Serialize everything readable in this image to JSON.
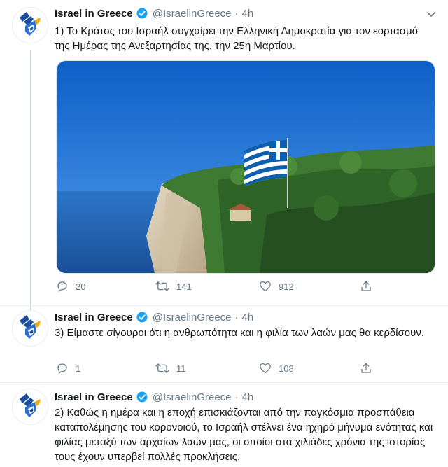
{
  "account": {
    "name": "Israel in Greece",
    "handle": "@IsraelinGreece"
  },
  "tweets": [
    {
      "time": "4h",
      "text": "1) Το Κράτος του Ισραήλ συγχαίρει την Ελληνική Δημοκρατία για τον εορτασμό της Ημέρας της Ανεξαρτησίας της, την 25η Μαρτίου.",
      "media": "photo of Greek flag on a cliff above the sea",
      "replies": "20",
      "retweets": "141",
      "likes": "912"
    },
    {
      "time": "4h",
      "text": "3) Είμαστε σίγουροι ότι η ανθρωπότητα και η φιλία των λαών μας θα κερδίσουν.",
      "replies": "1",
      "retweets": "11",
      "likes": "108"
    },
    {
      "time": "4h",
      "text": "2) Καθώς η ημέρα και η εποχή επισκιάζονται από την παγκόσμια προσπάθεια καταπολέμησης του κορονοιού, το Ισραήλ στέλνει ένα ηχηρό μήνυμα ενότητας και φιλίας μεταξύ των αρχαίων λαών μας, οι οποίοι στα χιλιάδες χρόνια της ιστορίας τους έχουν υπερβεί πολλές προκλήσεις."
    }
  ],
  "separator": "·",
  "icons": [
    "avatar-logo-icon",
    "verified-badge-icon",
    "caret-down-icon",
    "reply-icon",
    "retweet-icon",
    "like-icon",
    "share-icon"
  ],
  "colors": {
    "verified": "#1da1f2",
    "secondary_text": "#657786",
    "thread_line": "#ccd6dd"
  }
}
